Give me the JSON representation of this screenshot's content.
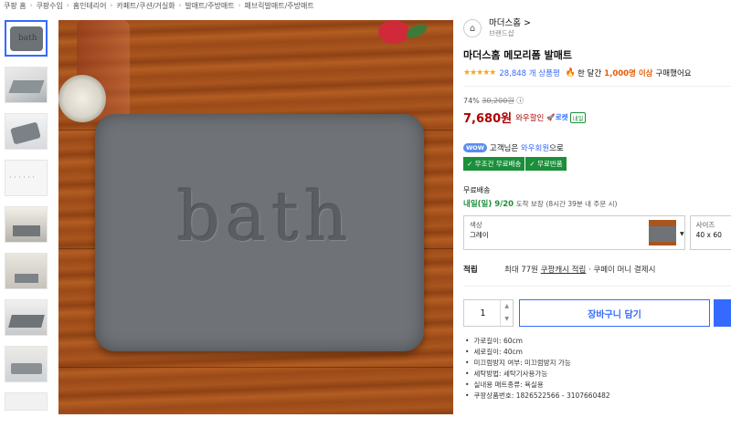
{
  "breadcrumb": [
    "쿠팡 홈",
    "쿠팡수입",
    "홈인테리어",
    "카페트/쿠션/거실화",
    "발매트/주방매트",
    "패브릭발매트/주방매트"
  ],
  "gallery": {
    "main_mat_text": "bath",
    "thumb_mat_text": "bath",
    "thumbnail_count": 9,
    "active_index": 0
  },
  "brand": {
    "name": "마더스홈",
    "chevron": ">",
    "subtitle": "브랜드샵"
  },
  "product": {
    "title": "마더스홈 메모리폼 발매트",
    "stars": "★★★★★",
    "rating": 5,
    "review_count": "28,848 개 상품평",
    "purchase_prefix": "한 달간",
    "purchase_highlight": "1,000명 이상",
    "purchase_suffix": "구매했어요"
  },
  "price": {
    "discount_rate": "74%",
    "original_price": "30,200원",
    "info_icon": "ⓘ",
    "sale_price": "7,680원",
    "wow_discount_label": "와우할인",
    "rocket_label": "🚀로켓",
    "rocket_badge": "내일"
  },
  "wow": {
    "badge": "WOW",
    "prefix": "고객님은",
    "link": "와우회원",
    "suffix": "으로"
  },
  "benefits": [
    "✓ 무조건 무료배송",
    "✓ 무료반품"
  ],
  "shipping": {
    "title": "무료배송",
    "date": "내일(일) 9/20",
    "guarantee": "도착 보장",
    "cutoff": "(8시간 39분 내 주문 시)"
  },
  "options": {
    "color_label": "색상",
    "color_value": "그레이",
    "size_label": "사이즈",
    "size_value": "40 x 60"
  },
  "cash": {
    "label": "적립",
    "prefix": "최대 77원",
    "link": "쿠팡캐시 적립",
    "suffix": "· 쿠페이 머니 결제시"
  },
  "cart": {
    "quantity": "1",
    "add_to_cart": "장바구니 담기"
  },
  "specs": [
    "가로길이: 60cm",
    "세로길이: 40cm",
    "미끄럼방지 여부: 미끄럼방지 가능",
    "세탁방법: 세탁기사용가능",
    "실내용 매트종류: 욕실용",
    "쿠팡상품번호: 1826522566 - 3107660482"
  ],
  "colors": {
    "accent_blue": "#346aff",
    "price_red": "#ae0000",
    "benefit_green": "#1b8f3a",
    "star_yellow": "#f5a623"
  }
}
